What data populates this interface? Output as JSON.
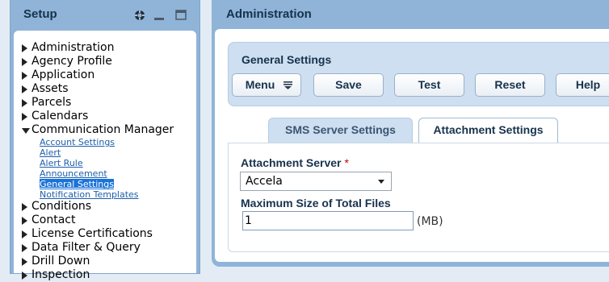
{
  "left_panel": {
    "title": "Setup",
    "icons": [
      "help-icon",
      "minimize-icon",
      "maximize-icon"
    ],
    "tree_before": [
      "Administration",
      "Agency Profile",
      "Application",
      "Assets",
      "Parcels",
      "Calendars"
    ],
    "open_item": "Communication Manager",
    "sub_items": [
      "Account Settings",
      "Alert",
      "Alert Rule",
      "Announcement",
      "General Settings",
      "Notification Templates"
    ],
    "selected_sub_item": "General Settings",
    "tree_after": [
      "Conditions",
      "Contact",
      "License Certifications",
      "Data Filter & Query",
      "Drill Down",
      "Inspection"
    ]
  },
  "right_panel": {
    "title": "Administration",
    "section_title": "General Settings",
    "buttons": {
      "menu": "Menu",
      "save": "Save",
      "test": "Test",
      "reset": "Reset",
      "help": "Help"
    },
    "tabs": [
      "SMS Server Settings",
      "Attachment Settings"
    ],
    "active_tab": "Attachment Settings",
    "form": {
      "server_label": "Attachment Server",
      "required_mark": "*",
      "server_value": "Accela",
      "size_label": "Maximum Size of Total Files",
      "size_value": "1",
      "size_unit": "(MB)"
    }
  },
  "colors": {
    "panel_bg": "#8fb4d8",
    "section_bg": "#cddff0",
    "link": "#1e5faa",
    "selected": "#1a73d9",
    "required": "#cc0000"
  }
}
